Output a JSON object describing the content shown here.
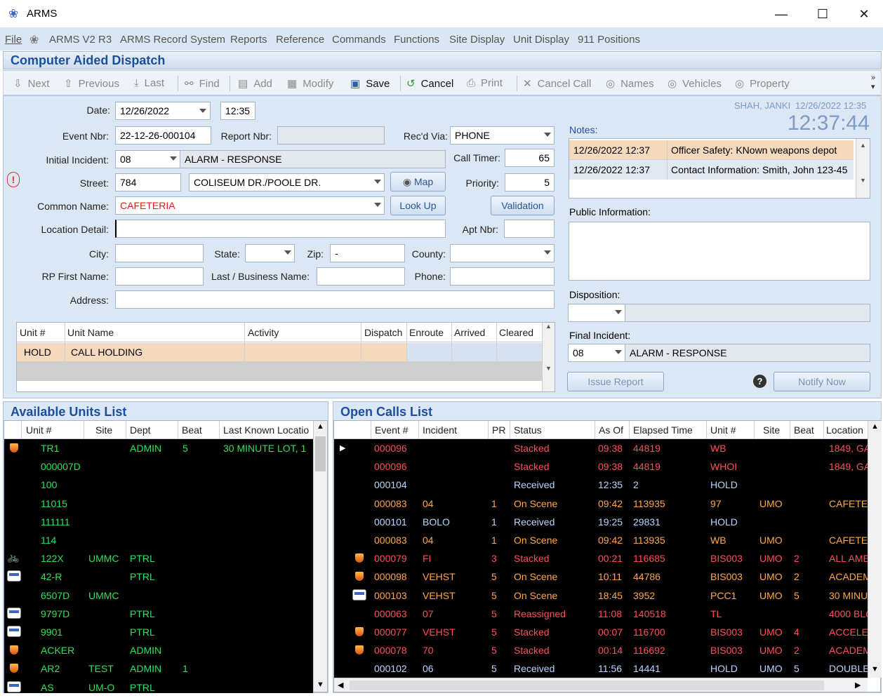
{
  "window": {
    "title": "ARMS",
    "minimize": "—",
    "maximize": "☐",
    "close": "✕"
  },
  "menu": [
    "File",
    "ARMS V2 R3",
    "ARMS Record System",
    "Reports",
    "Reference",
    "Commands",
    "Functions",
    "Site Display",
    "Unit Display",
    "911 Positions"
  ],
  "cad_title": "Computer Aided Dispatch",
  "toolbar": {
    "next": "Next",
    "previous": "Previous",
    "last": "Last",
    "find": "Find",
    "add": "Add",
    "modify": "Modify",
    "save": "Save",
    "cancel": "Cancel",
    "print": "Print",
    "cancel_call": "Cancel Call",
    "names": "Names",
    "vehicles": "Vehicles",
    "property": "Property"
  },
  "form": {
    "date_label": "Date:",
    "date": "12/26/2022",
    "time": "12:35",
    "event_label": "Event Nbr:",
    "event": "22-12-26-000104",
    "report_label": "Report Nbr:",
    "report": "",
    "recd_label": "Rec'd Via:",
    "recd": "PHONE",
    "incident_label": "Initial Incident:",
    "incident_code": "08",
    "incident_desc": "ALARM - RESPONSE",
    "call_timer_label": "Call Timer:",
    "call_timer": "65",
    "street_label": "Street:",
    "street_no": "784",
    "street_name": "COLISEUM DR./POOLE DR.",
    "map": "Map",
    "priority_label": "Priority:",
    "priority": "5",
    "common_label": "Common Name:",
    "common": "CAFETERIA",
    "lookup": "Look Up",
    "validation": "Validation",
    "locdetail_label": "Location Detail:",
    "locdetail": "",
    "apt_label": "Apt Nbr:",
    "apt": "",
    "city_label": "City:",
    "state_label": "State:",
    "zip_label": "Zip:",
    "zip": "-",
    "county_label": "County:",
    "rpfirst_label": "RP First Name:",
    "lastbiz_label": "Last / Business Name:",
    "phone_label": "Phone:",
    "address_label": "Address:"
  },
  "unit_grid": {
    "headers": [
      "Unit #",
      "Unit Name",
      "Activity",
      "Dispatch",
      "Enroute",
      "Arrived",
      "Cleared"
    ],
    "rows": [
      {
        "unit": "HOLD",
        "name": "CALL HOLDING"
      }
    ]
  },
  "right": {
    "user": "SHAH, JANKI",
    "user_time": "12/26/2022 12:35",
    "clock": "12:37:44",
    "notes_label": "Notes:",
    "notes": [
      {
        "time": "12/26/2022 12:37",
        "text": "Officer Safety: KNown weapons depot"
      },
      {
        "time": "12/26/2022 12:37",
        "text": "Contact Information: Smith, John 123-45"
      }
    ],
    "public_label": "Public Information:",
    "disposition_label": "Disposition:",
    "final_label": "Final Incident:",
    "final_code": "08",
    "final_desc": "ALARM - RESPONSE",
    "issue_report": "Issue Report",
    "notify_now": "Notify Now",
    "help": "?"
  },
  "available": {
    "title": "Available Units List",
    "headers": [
      "Unit #",
      "Site",
      "Dept",
      "Beat",
      "Last Known Locatio"
    ],
    "rows": [
      {
        "icon": "shield",
        "unit": "TR1",
        "site": "",
        "dept": "ADMIN",
        "beat": "5",
        "loc": "30 MINUTE LOT, 1"
      },
      {
        "icon": "",
        "unit": "000007D",
        "site": "",
        "dept": "",
        "beat": "",
        "loc": ""
      },
      {
        "icon": "",
        "unit": "100",
        "site": "",
        "dept": "",
        "beat": "",
        "loc": ""
      },
      {
        "icon": "",
        "unit": "11015",
        "site": "",
        "dept": "",
        "beat": "",
        "loc": ""
      },
      {
        "icon": "",
        "unit": "111111",
        "site": "",
        "dept": "",
        "beat": "",
        "loc": ""
      },
      {
        "icon": "",
        "unit": "114",
        "site": "",
        "dept": "",
        "beat": "",
        "loc": ""
      },
      {
        "icon": "bike",
        "unit": "122X",
        "site": "UMMC",
        "dept": "PTRL",
        "beat": "",
        "loc": ""
      },
      {
        "icon": "car",
        "unit": "42-R",
        "site": "",
        "dept": "PTRL",
        "beat": "",
        "loc": ""
      },
      {
        "icon": "",
        "unit": "6507D",
        "site": "UMMC",
        "dept": "",
        "beat": "",
        "loc": ""
      },
      {
        "icon": "car",
        "unit": "9797D",
        "site": "",
        "dept": "PTRL",
        "beat": "",
        "loc": ""
      },
      {
        "icon": "car",
        "unit": "9901",
        "site": "",
        "dept": "PTRL",
        "beat": "",
        "loc": ""
      },
      {
        "icon": "shield",
        "unit": "ACKER",
        "site": "",
        "dept": "ADMIN",
        "beat": "",
        "loc": ""
      },
      {
        "icon": "shield",
        "unit": "AR2",
        "site": "TEST",
        "dept": "ADMIN",
        "beat": "1",
        "loc": ""
      },
      {
        "icon": "car",
        "unit": "AS",
        "site": "UM-O",
        "dept": "PTRL",
        "beat": "",
        "loc": ""
      }
    ]
  },
  "open": {
    "title": "Open Calls List",
    "headers": [
      "Event #",
      "Incident",
      "PR",
      "Status",
      "As Of",
      "Elapsed Time",
      "Unit #",
      "Site",
      "Beat",
      "Location"
    ],
    "rows": [
      {
        "c": "rd",
        "icon": "arrow",
        "ev": "000096",
        "inc": "",
        "pr": "",
        "st": "Stacked",
        "asof": "09:38",
        "el": "44819",
        "unit": "WB",
        "site": "",
        "beat": "",
        "loc": "1849, GA"
      },
      {
        "c": "rd",
        "icon": "",
        "ev": "000096",
        "inc": "",
        "pr": "",
        "st": "Stacked",
        "asof": "09:38",
        "el": "44819",
        "unit": "WHOI",
        "site": "",
        "beat": "",
        "loc": "1849, GA"
      },
      {
        "c": "bl",
        "icon": "",
        "ev": "000104",
        "inc": "",
        "pr": "",
        "st": "Received",
        "asof": "12:35",
        "el": "2",
        "unit": "HOLD",
        "site": "",
        "beat": "",
        "loc": ""
      },
      {
        "c": "or",
        "icon": "",
        "ev": "000083",
        "inc": "04",
        "pr": "1",
        "st": "On Scene",
        "asof": "09:42",
        "el": "113935",
        "unit": "97",
        "site": "UMO",
        "beat": "",
        "loc": "CAFETEI"
      },
      {
        "c": "bl",
        "icon": "",
        "ev": "000101",
        "inc": "BOLO",
        "pr": "1",
        "st": "Received",
        "asof": "19:25",
        "el": "29831",
        "unit": "HOLD",
        "site": "",
        "beat": "",
        "loc": ""
      },
      {
        "c": "or",
        "icon": "",
        "ev": "000083",
        "inc": "04",
        "pr": "1",
        "st": "On Scene",
        "asof": "09:42",
        "el": "113935",
        "unit": "WB",
        "site": "UMO",
        "beat": "",
        "loc": "CAFETEI"
      },
      {
        "c": "rd",
        "icon": "shield",
        "ev": "000079",
        "inc": "FI",
        "pr": "3",
        "st": "Stacked",
        "asof": "00:21",
        "el": "116685",
        "unit": "BIS003",
        "site": "UMO",
        "beat": "2",
        "loc": "ALL AME"
      },
      {
        "c": "or",
        "icon": "shield",
        "ev": "000098",
        "inc": "VEHST",
        "pr": "5",
        "st": "On Scene",
        "asof": "10:11",
        "el": "44786",
        "unit": "BIS003",
        "site": "UMO",
        "beat": "2",
        "loc": "ACADEM"
      },
      {
        "c": "or",
        "icon": "car",
        "ev": "000103",
        "inc": "VEHST",
        "pr": "5",
        "st": "On Scene",
        "asof": "18:45",
        "el": "3952",
        "unit": "PCC1",
        "site": "UMO",
        "beat": "5",
        "loc": "30 MINUT"
      },
      {
        "c": "rd",
        "icon": "",
        "ev": "000063",
        "inc": "07",
        "pr": "5",
        "st": "Reassigned",
        "asof": "11:08",
        "el": "140518",
        "unit": "TL",
        "site": "",
        "beat": "",
        "loc": "4000 BLC"
      },
      {
        "c": "rd",
        "icon": "shield",
        "ev": "000077",
        "inc": "VEHST",
        "pr": "5",
        "st": "Stacked",
        "asof": "00:07",
        "el": "116700",
        "unit": "BIS003",
        "site": "UMO",
        "beat": "4",
        "loc": "ACCELEI"
      },
      {
        "c": "rd",
        "icon": "shield",
        "ev": "000078",
        "inc": "70",
        "pr": "5",
        "st": "Stacked",
        "asof": "00:14",
        "el": "116692",
        "unit": "BIS003",
        "site": "UMO",
        "beat": "2",
        "loc": "ACADEM"
      },
      {
        "c": "bl",
        "icon": "",
        "ev": "000102",
        "inc": "06",
        "pr": "5",
        "st": "Received",
        "asof": "11:56",
        "el": "14441",
        "unit": "HOLD",
        "site": "UMO",
        "beat": "5",
        "loc": "DOUBLE"
      }
    ]
  }
}
